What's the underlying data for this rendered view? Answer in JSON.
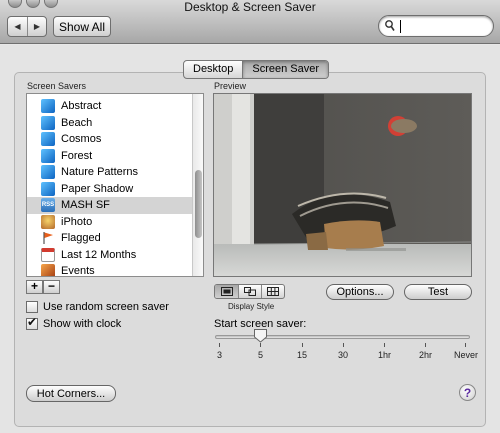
{
  "window": {
    "title": "Desktop & Screen Saver"
  },
  "toolbar": {
    "back_icon": "back-arrow-icon",
    "forward_icon": "forward-arrow-icon",
    "show_all_label": "Show All",
    "search_value": "",
    "search_icon": "search-icon"
  },
  "tabs": [
    {
      "label": "Desktop",
      "selected": false
    },
    {
      "label": "Screen Saver",
      "selected": true
    }
  ],
  "screen_savers": {
    "heading": "Screen Savers",
    "items": [
      {
        "label": "Abstract",
        "icon": "screensaver-icon",
        "selected": false
      },
      {
        "label": "Beach",
        "icon": "screensaver-icon",
        "selected": false
      },
      {
        "label": "Cosmos",
        "icon": "screensaver-icon",
        "selected": false
      },
      {
        "label": "Forest",
        "icon": "screensaver-icon",
        "selected": false
      },
      {
        "label": "Nature Patterns",
        "icon": "screensaver-icon",
        "selected": false
      },
      {
        "label": "Paper Shadow",
        "icon": "screensaver-icon",
        "selected": false
      },
      {
        "label": "MASH SF",
        "icon": "rss-icon",
        "selected": true
      },
      {
        "label": "iPhoto",
        "icon": "iphoto-icon",
        "selected": false
      },
      {
        "label": "Flagged",
        "icon": "flag-icon",
        "selected": false
      },
      {
        "label": "Last 12 Months",
        "icon": "calendar-icon",
        "selected": false
      },
      {
        "label": "Events",
        "icon": "events-icon",
        "selected": false
      }
    ],
    "add_label": "+",
    "remove_label": "−"
  },
  "options": {
    "random_label": "Use random screen saver",
    "random_checked": false,
    "clock_label": "Show with clock",
    "clock_checked": true
  },
  "preview": {
    "heading": "Preview"
  },
  "display_style": {
    "label": "Display Style",
    "modes": [
      "single-image-icon",
      "mosaic-icon",
      "grid-icon"
    ],
    "active": 0
  },
  "buttons": {
    "options_label": "Options...",
    "test_label": "Test",
    "hot_corners_label": "Hot Corners...",
    "help_label": "?"
  },
  "slider": {
    "label": "Start screen saver:",
    "ticks": [
      "3",
      "5",
      "15",
      "30",
      "1hr",
      "2hr",
      "Never"
    ],
    "value": "5"
  },
  "colors": {
    "selection": "#d4d4d4",
    "screensaver_icon": "#1f8ad6",
    "help_mark": "#5a2aa0"
  }
}
